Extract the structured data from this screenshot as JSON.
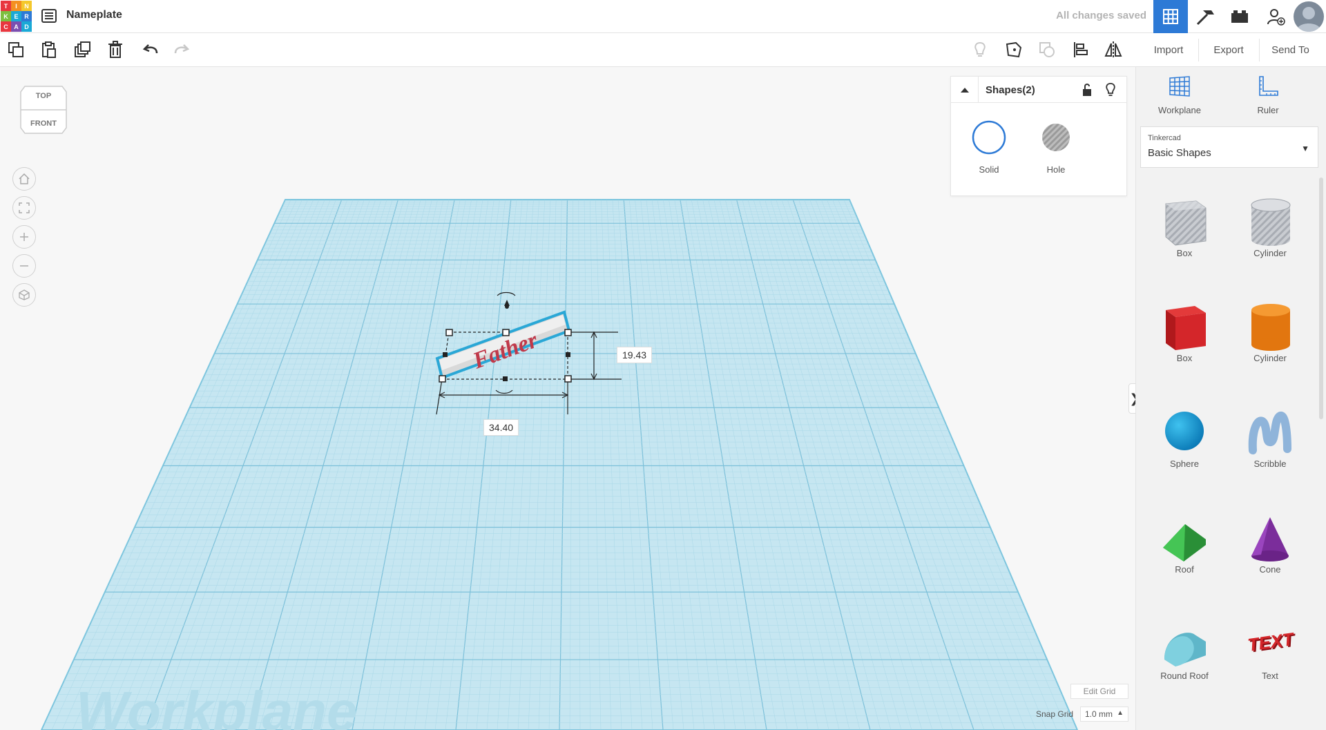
{
  "app": {
    "title": "Nameplate",
    "status": "All changes saved"
  },
  "logo": {
    "letters": [
      "T",
      "I",
      "N",
      "K",
      "E",
      "R",
      "C",
      "A",
      "D"
    ],
    "colors": [
      "#e8373f",
      "#f49021",
      "#f4c82d",
      "#7cbf3f",
      "#1aa9d6",
      "#2d7ad6",
      "#e8373f",
      "#7b4fb0",
      "#1aa9d6"
    ]
  },
  "toolbar": {
    "items": [
      "copy-icon",
      "paste-icon",
      "duplicate-icon",
      "delete-icon",
      "undo-icon",
      "redo-icon",
      "light-bulb-icon",
      "note-icon",
      "group-icon",
      "align-icon",
      "mirror-icon"
    ],
    "import_label": "Import",
    "export_label": "Export",
    "sendto_label": "Send To"
  },
  "viewcube": {
    "top": "TOP",
    "front": "FRONT"
  },
  "canvas": {
    "shape_text": "Father",
    "dim_height": "19.43",
    "dim_width": "34.40",
    "workplane_watermark": "Workplane"
  },
  "inspector": {
    "title": "Shapes(2)",
    "solid_label": "Solid",
    "hole_label": "Hole"
  },
  "right_panel": {
    "workplane_label": "Workplane",
    "ruler_label": "Ruler",
    "library_provider": "Tinkercad",
    "library_value": "Basic Shapes",
    "shapes": [
      {
        "label": "Box",
        "icon": "box-hole-icon"
      },
      {
        "label": "Cylinder",
        "icon": "cylinder-hole-icon"
      },
      {
        "label": "Box",
        "icon": "box-red-icon"
      },
      {
        "label": "Cylinder",
        "icon": "cylinder-orange-icon"
      },
      {
        "label": "Sphere",
        "icon": "sphere-icon"
      },
      {
        "label": "Scribble",
        "icon": "scribble-icon"
      },
      {
        "label": "Roof",
        "icon": "roof-icon"
      },
      {
        "label": "Cone",
        "icon": "cone-icon"
      },
      {
        "label": "Round Roof",
        "icon": "round-roof-icon"
      },
      {
        "label": "Text",
        "icon": "text-shape-icon"
      }
    ]
  },
  "grid": {
    "edit_label": "Edit Grid",
    "snap_label": "Snap Grid",
    "snap_value": "1.0 mm"
  },
  "colors": {
    "accent": "#2d7ad6",
    "plane": "#c6e6f1",
    "grid_line": "#8fcbe0",
    "shape_text": "#c0394a"
  }
}
